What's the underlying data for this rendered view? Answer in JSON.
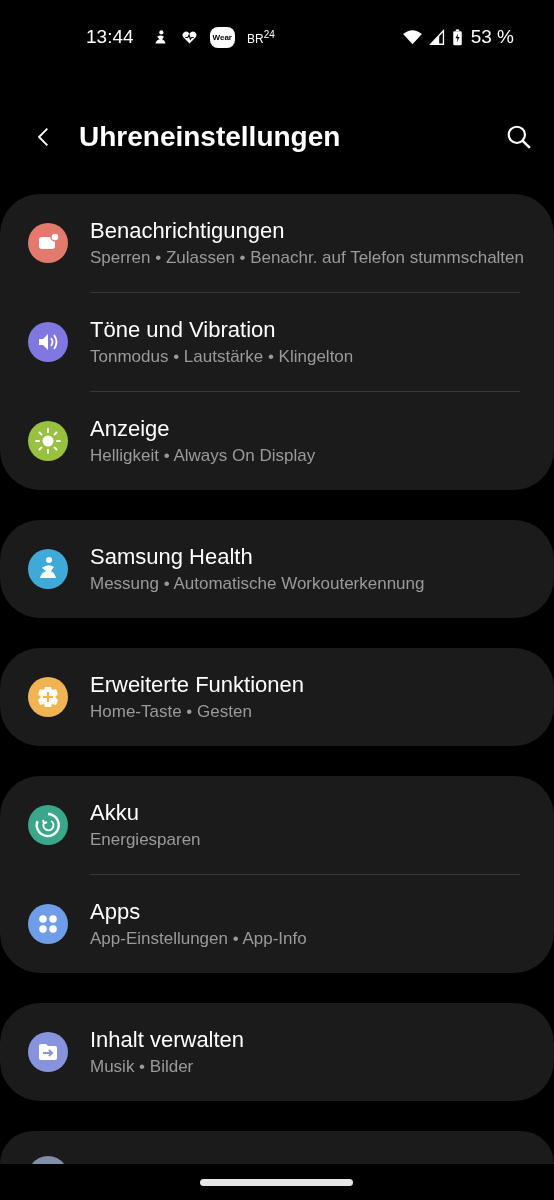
{
  "status_bar": {
    "time": "13:44",
    "wear_badge": "Wear",
    "br_logo": "BR$^{24}$",
    "battery": "53 %"
  },
  "header": {
    "title": "Uhreneinstellungen"
  },
  "groups": [
    {
      "items": [
        {
          "title": "Benachrichtigungen",
          "subtitle": "Sperren • Zulassen • Benachr. auf Telefon stummschalten",
          "color": "#e27b6e"
        },
        {
          "title": "Töne und Vibration",
          "subtitle": "Tonmodus • Lautstärke • Klingelton",
          "color": "#7f78e0"
        },
        {
          "title": "Anzeige",
          "subtitle": "Helligkeit • Always On Display",
          "color": "#98c13f"
        }
      ]
    },
    {
      "items": [
        {
          "title": "Samsung Health",
          "subtitle": "Messung • Automatische Workouterkennung",
          "color": "#3fa9d8"
        }
      ]
    },
    {
      "items": [
        {
          "title": "Erweiterte Funktionen",
          "subtitle": "Home-Taste • Gesten",
          "color": "#f0b552"
        }
      ]
    },
    {
      "items": [
        {
          "title": "Akku",
          "subtitle": "Energiesparen",
          "color": "#3aa68a"
        },
        {
          "title": "Apps",
          "subtitle": "App-Einstellungen • App-Info",
          "color": "#6f9de8"
        }
      ]
    },
    {
      "items": [
        {
          "title": "Inhalt verwalten",
          "subtitle": "Musik • Bilder",
          "color": "#8793dc"
        }
      ]
    }
  ]
}
